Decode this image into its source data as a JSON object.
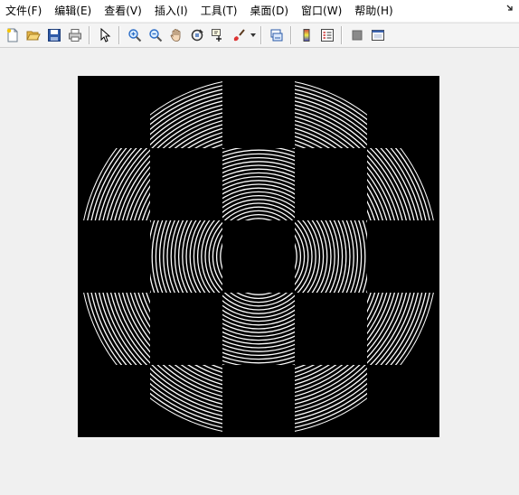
{
  "menubar": {
    "items": [
      {
        "label": "文件(F)"
      },
      {
        "label": "编辑(E)"
      },
      {
        "label": "查看(V)"
      },
      {
        "label": "插入(I)"
      },
      {
        "label": "工具(T)"
      },
      {
        "label": "桌面(D)"
      },
      {
        "label": "窗口(W)"
      },
      {
        "label": "帮助(H)"
      }
    ],
    "corner_icon": "dock-arrow-icon"
  },
  "toolbar": {
    "buttons": [
      {
        "icon": "new-figure-icon"
      },
      {
        "icon": "open-file-icon"
      },
      {
        "icon": "save-icon"
      },
      {
        "icon": "print-icon"
      },
      {
        "icon": "pointer-icon"
      },
      {
        "icon": "zoom-in-icon"
      },
      {
        "icon": "zoom-out-icon"
      },
      {
        "icon": "pan-hand-icon"
      },
      {
        "icon": "rotate-3d-icon"
      },
      {
        "icon": "data-cursor-icon"
      },
      {
        "icon": "brush-icon"
      },
      {
        "icon": "link-plot-icon"
      },
      {
        "icon": "colorbar-icon"
      },
      {
        "icon": "legend-icon"
      },
      {
        "icon": "hide-plot-tools-icon"
      },
      {
        "icon": "show-plot-tools-icon"
      }
    ]
  },
  "figure": {
    "background": "#f0f0f0",
    "axes_background": "#000000",
    "pattern_color": "#ffffff",
    "pattern": "concentric-ring-arcs-masked-by-checkerboard-in-disk"
  }
}
